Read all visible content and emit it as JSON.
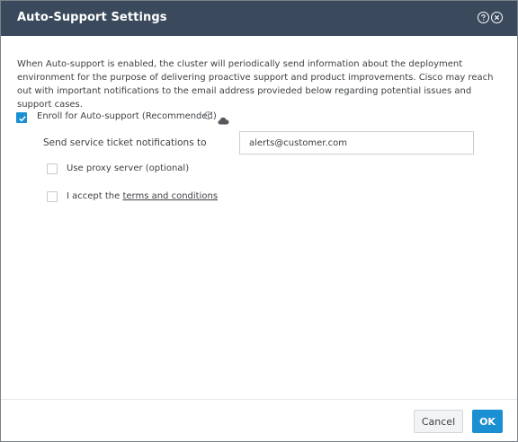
{
  "dialog": {
    "title": "Auto-Support Settings",
    "help_icon": "help-circle-icon",
    "close_icon": "close-circle-icon"
  },
  "description": "When Auto-support is enabled, the cluster will periodically send information about the deployment environment for the purpose of delivering proactive support and product improvements. Cisco may reach out with important notifications to the email address provieded below regarding potential issues and support cases.",
  "enroll": {
    "label": "Enroll for Auto-support (Recommended)",
    "checked": true,
    "info_icon": "info-icon",
    "cloud_icon": "cloud-icon"
  },
  "notifications": {
    "label": "Send service ticket notifications to",
    "email": "alerts@customer.com"
  },
  "proxy": {
    "label": "Use proxy server (optional)",
    "checked": false
  },
  "terms": {
    "label_prefix": "I accept the",
    "link_text": "terms and conditions",
    "checked": false
  },
  "footer": {
    "cancel_label": "Cancel",
    "ok_label": "OK"
  },
  "colors": {
    "header_bg": "#3a4a5c",
    "accent": "#1a8fd1",
    "text": "#3e4145"
  }
}
